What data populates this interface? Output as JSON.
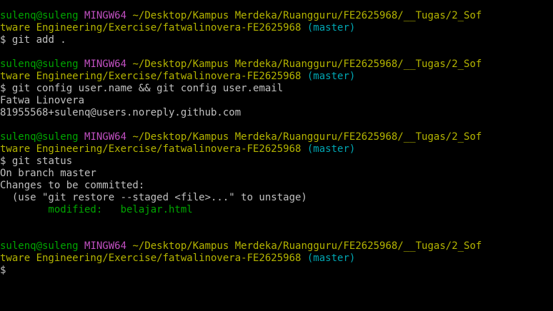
{
  "colors": {
    "background": "#000000",
    "user_host": "#00a600",
    "system": "#c150c1",
    "path": "#b5b500",
    "branch": "#00a6b2",
    "text": "#c0c0c0",
    "modified": "#00a600"
  },
  "prompt": {
    "user_host": "sulenq@suleng",
    "system": "MINGW64",
    "path_line1": "~/Desktop/Kampus Merdeka/Ruangguru/FE2625968/__Tugas/2_Sof",
    "path_line2": "tware Engineering/Exercise/fatwalinovera-FE2625968",
    "branch": "(master)",
    "symbol": "$"
  },
  "blocks": [
    {
      "command": "git add .",
      "output": []
    },
    {
      "command": "git config user.name && git config user.email",
      "output": [
        "Fatwa Linovera",
        "81955568+sulenq@users.noreply.github.com"
      ]
    },
    {
      "command": "git status",
      "output": [
        "On branch master",
        "Changes to be committed:",
        "  (use \"git restore --staged <file>...\" to unstage)"
      ],
      "modified_label": "        modified:   belajar.html"
    },
    {
      "command": "",
      "output": []
    }
  ]
}
